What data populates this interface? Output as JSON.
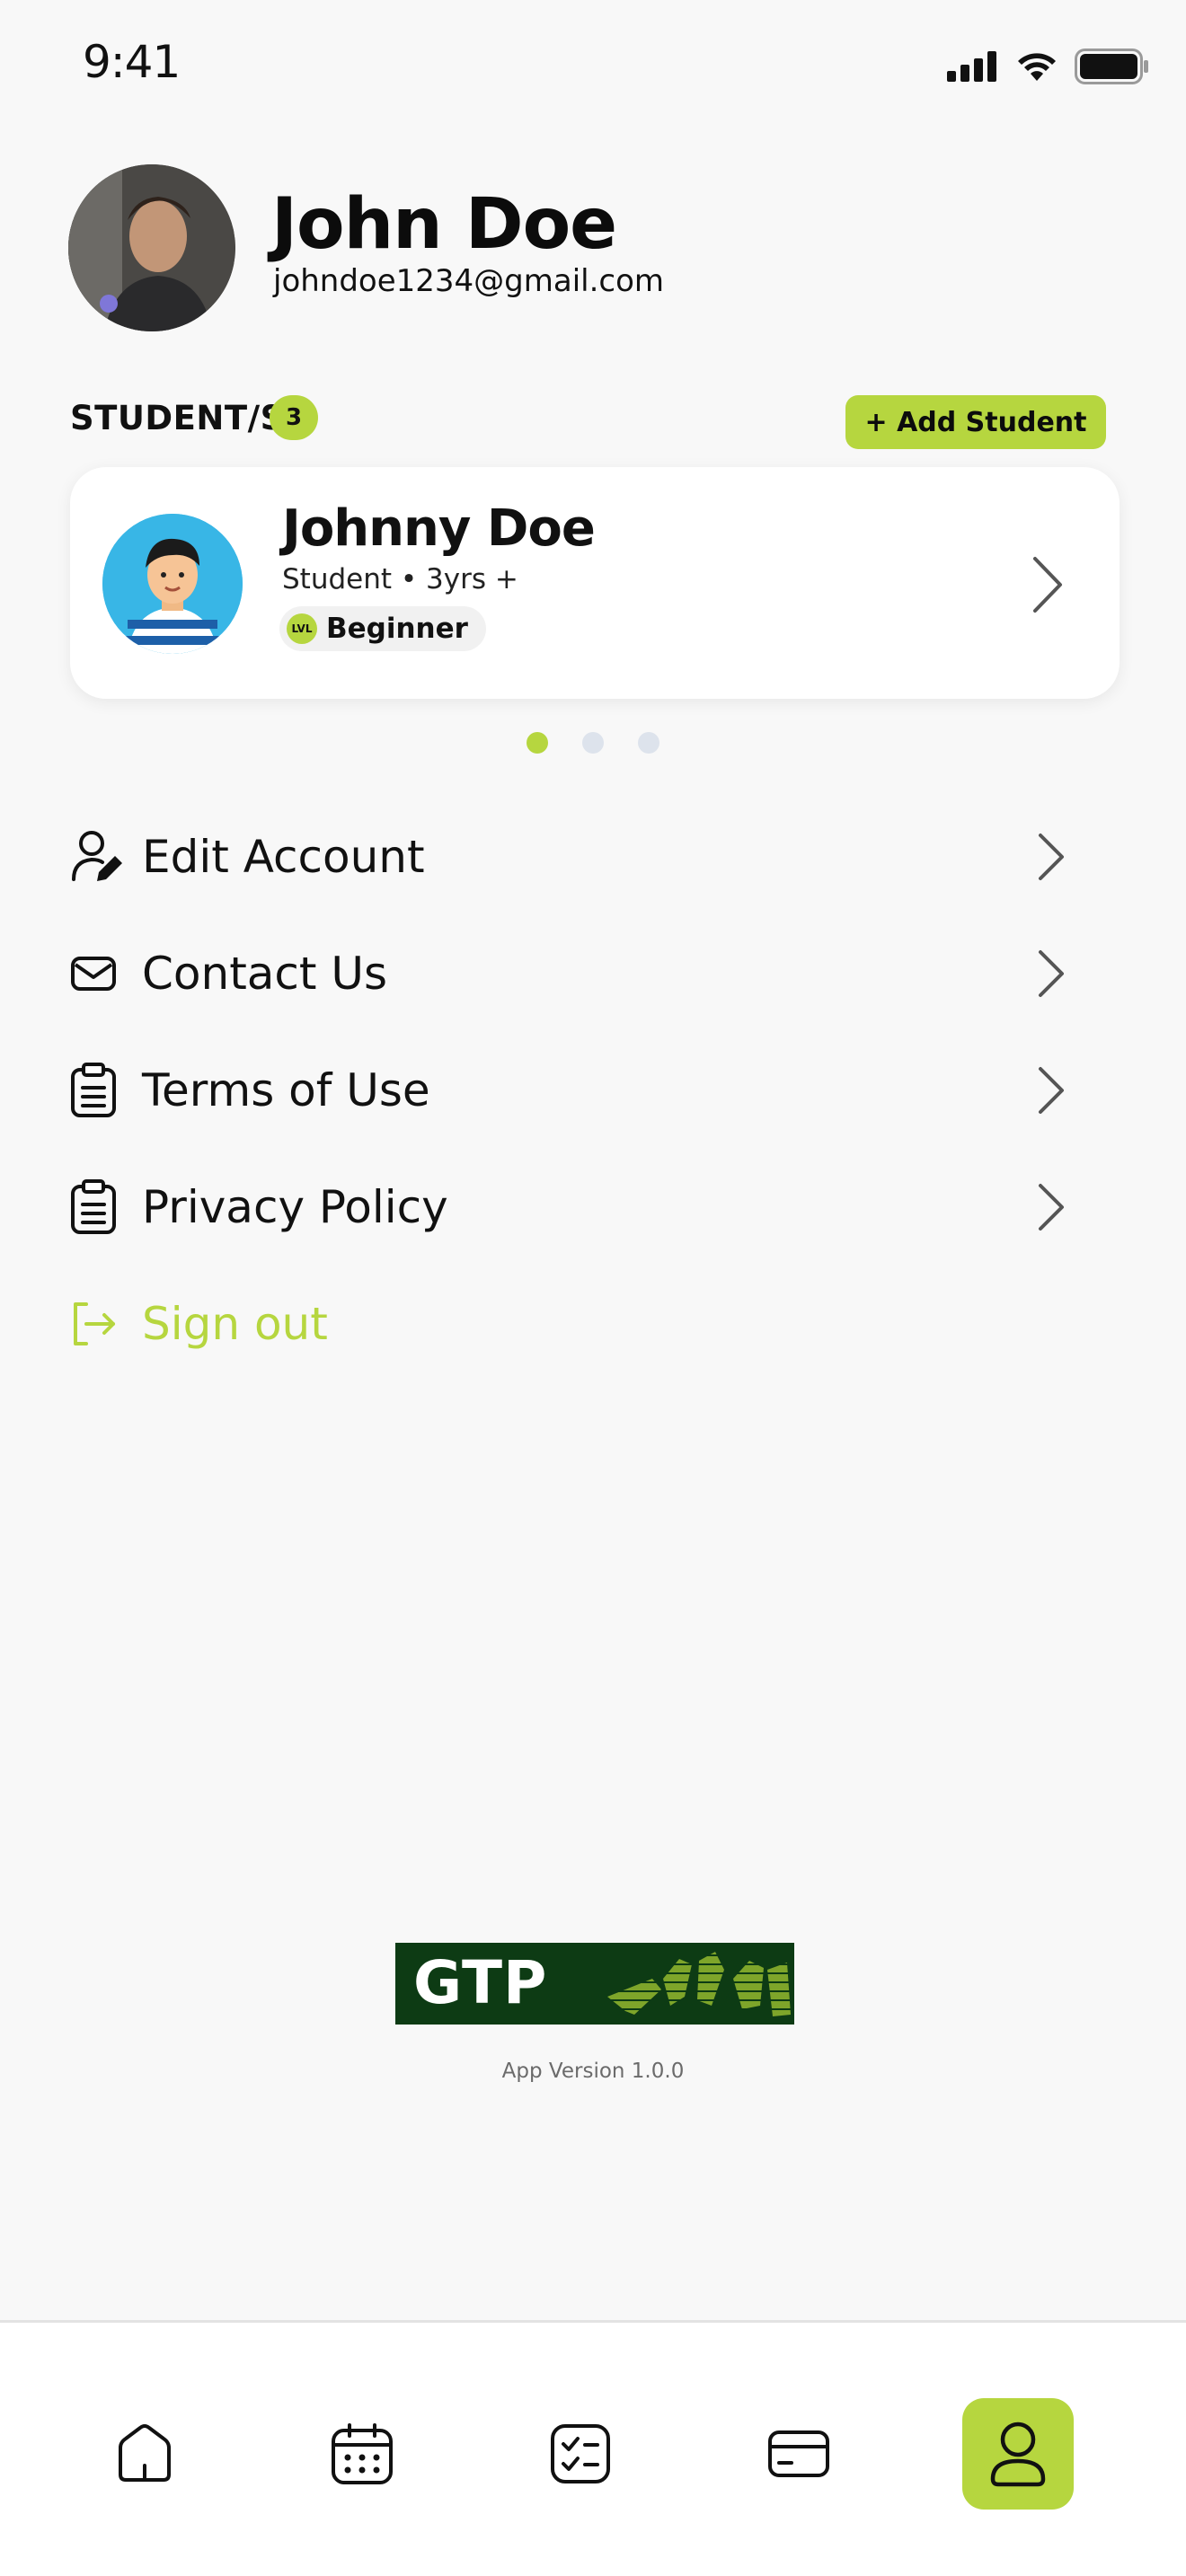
{
  "status_bar": {
    "time": "9:41",
    "icons": [
      "signal-icon",
      "wifi-icon",
      "battery-icon"
    ]
  },
  "profile": {
    "name": "John Doe",
    "email": "johndoe1234@gmail.com"
  },
  "students": {
    "label": "STUDENT/S",
    "count": "3",
    "add_button": "+ Add Student",
    "current_page": 1,
    "total_pages": 3,
    "items": [
      {
        "name": "Johnny Doe",
        "meta": "Student • 3yrs +",
        "level_badge": "LVL",
        "level": "Beginner"
      }
    ]
  },
  "menu": {
    "items": [
      {
        "label": "Edit Account",
        "icon": "user-edit-icon"
      },
      {
        "label": "Contact Us",
        "icon": "mail-icon"
      },
      {
        "label": "Terms of Use",
        "icon": "clipboard-icon"
      },
      {
        "label": "Privacy Policy",
        "icon": "clipboard-icon"
      }
    ],
    "signout": {
      "label": "Sign out",
      "icon": "logout-icon"
    }
  },
  "footer": {
    "logo_text": "GTP",
    "version": "App Version 1.0.0"
  },
  "bottom_nav": {
    "items": [
      "home-icon",
      "calendar-icon",
      "checklist-icon",
      "card-icon",
      "profile-icon"
    ],
    "active": "profile-icon"
  },
  "colors": {
    "accent": "#b6d63f",
    "background": "#f8f8f8",
    "card": "#ffffff",
    "logo_bg": "#0d3b14"
  }
}
